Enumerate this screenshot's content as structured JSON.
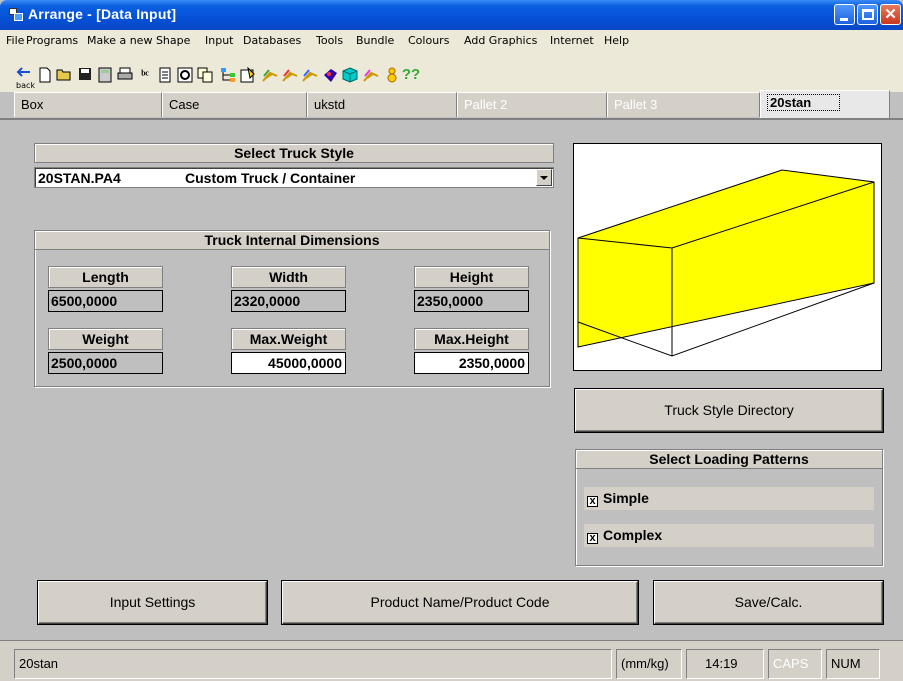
{
  "window": {
    "title": "Arrange - [Data Input]",
    "controls": [
      "minimize-icon",
      "maximize-icon",
      "close-icon"
    ]
  },
  "menu": [
    "File",
    "Programs",
    "Make a new Shape",
    "Input",
    "Databases",
    "Tools",
    "Bundle",
    "Colours",
    "Add Graphics",
    "Internet",
    "Help"
  ],
  "toolbar": {
    "back_label": "back",
    "help_label": "??",
    "icons": [
      "back-icon",
      "new-icon",
      "open-icon",
      "save-icon",
      "calculator-icon",
      "print-icon",
      "abc-icon",
      "document-icon",
      "preview-icon",
      "copy-icon",
      "tree-icon",
      "properties-icon",
      "pallet-icon",
      "pallet2-icon",
      "pallet3-icon",
      "palette-icon",
      "box-icon",
      "pallet4-icon",
      "stack-icon",
      "help-icon"
    ]
  },
  "tabs": [
    {
      "label": "Box",
      "state": "normal"
    },
    {
      "label": "Case",
      "state": "normal"
    },
    {
      "label": "ukstd",
      "state": "normal"
    },
    {
      "label": "Pallet 2",
      "state": "disabled"
    },
    {
      "label": "Pallet 3",
      "state": "disabled"
    },
    {
      "label": "20stan",
      "state": "active"
    }
  ],
  "truck_style": {
    "header": "Select Truck Style",
    "selected_code": "20STAN.PA4",
    "selected_desc": "Custom Truck / Container"
  },
  "dimensions": {
    "header": "Truck Internal Dimensions",
    "length": {
      "label": "Length",
      "value": "6500,0000"
    },
    "width": {
      "label": "Width",
      "value": "2320,0000"
    },
    "height": {
      "label": "Height",
      "value": "2350,0000"
    },
    "weight": {
      "label": "Weight",
      "value": "2500,0000"
    },
    "max_weight": {
      "label": "Max.Weight",
      "value": "45000,0000"
    },
    "max_height": {
      "label": "Max.Height",
      "value": "2350,0000"
    }
  },
  "preview": {
    "fill": "#ffff00",
    "stroke": "#000000"
  },
  "directory_button": "Truck Style Directory",
  "loading_patterns": {
    "header": "Select Loading Patterns",
    "simple": {
      "label": "Simple",
      "checked": true
    },
    "complex": {
      "label": "Complex",
      "checked": true
    },
    "check_mark": "x"
  },
  "bottom_buttons": {
    "input_settings": "Input Settings",
    "product_name": "Product Name/Product Code",
    "save_calc": "Save/Calc."
  },
  "status": {
    "name": "20stan",
    "units": "(mm/kg)",
    "time": "14:19",
    "caps": "CAPS",
    "num": "NUM"
  }
}
